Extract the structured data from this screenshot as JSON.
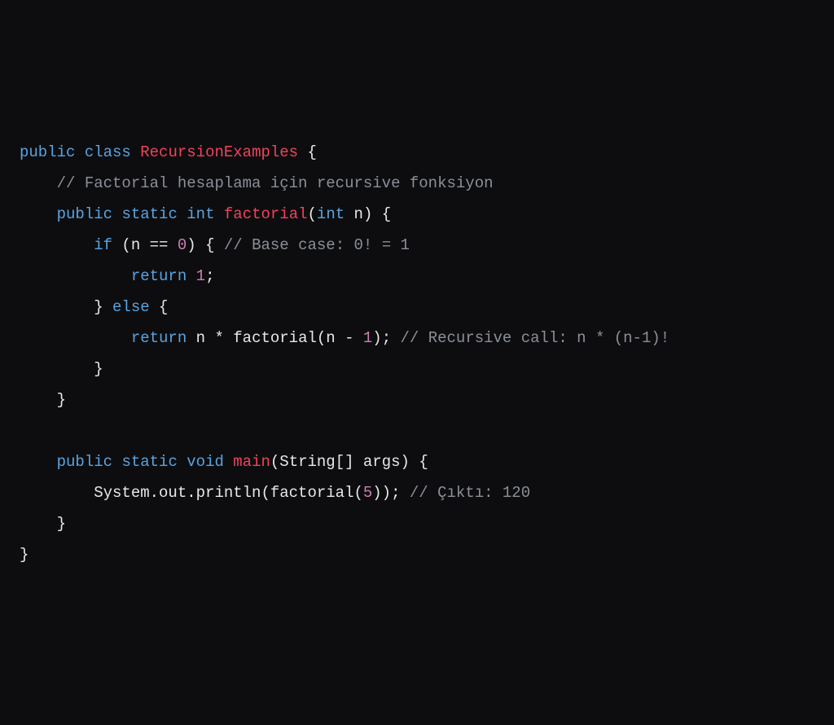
{
  "code": {
    "tokens": [
      [
        {
          "t": "public",
          "c": "kw"
        },
        {
          "t": " ",
          "c": "pn"
        },
        {
          "t": "class",
          "c": "kw"
        },
        {
          "t": " ",
          "c": "pn"
        },
        {
          "t": "RecursionExamples",
          "c": "cls"
        },
        {
          "t": " {",
          "c": "pn"
        }
      ],
      [
        {
          "t": "    ",
          "c": "pn"
        },
        {
          "t": "// Factorial hesaplama için recursive fonksiyon",
          "c": "cm"
        }
      ],
      [
        {
          "t": "    ",
          "c": "pn"
        },
        {
          "t": "public",
          "c": "kw"
        },
        {
          "t": " ",
          "c": "pn"
        },
        {
          "t": "static",
          "c": "kw"
        },
        {
          "t": " ",
          "c": "pn"
        },
        {
          "t": "int",
          "c": "type"
        },
        {
          "t": " ",
          "c": "pn"
        },
        {
          "t": "factorial",
          "c": "fn"
        },
        {
          "t": "(",
          "c": "pn"
        },
        {
          "t": "int",
          "c": "type"
        },
        {
          "t": " n) {",
          "c": "pn"
        }
      ],
      [
        {
          "t": "        ",
          "c": "pn"
        },
        {
          "t": "if",
          "c": "kw"
        },
        {
          "t": " (n ",
          "c": "pn"
        },
        {
          "t": "==",
          "c": "pn"
        },
        {
          "t": " ",
          "c": "pn"
        },
        {
          "t": "0",
          "c": "num"
        },
        {
          "t": ") { ",
          "c": "pn"
        },
        {
          "t": "// Base case: 0! = 1",
          "c": "cm"
        }
      ],
      [
        {
          "t": "            ",
          "c": "pn"
        },
        {
          "t": "return",
          "c": "kw"
        },
        {
          "t": " ",
          "c": "pn"
        },
        {
          "t": "1",
          "c": "num"
        },
        {
          "t": ";",
          "c": "pn"
        }
      ],
      [
        {
          "t": "        } ",
          "c": "pn"
        },
        {
          "t": "else",
          "c": "kw"
        },
        {
          "t": " {",
          "c": "pn"
        }
      ],
      [
        {
          "t": "            ",
          "c": "pn"
        },
        {
          "t": "return",
          "c": "kw"
        },
        {
          "t": " n * factorial(n - ",
          "c": "pn"
        },
        {
          "t": "1",
          "c": "num"
        },
        {
          "t": "); ",
          "c": "pn"
        },
        {
          "t": "// Recursive call: n * (n-1)!",
          "c": "cm"
        }
      ],
      [
        {
          "t": "        }",
          "c": "pn"
        }
      ],
      [
        {
          "t": "    }",
          "c": "pn"
        }
      ],
      [
        {
          "t": "",
          "c": "pn"
        }
      ],
      [
        {
          "t": "    ",
          "c": "pn"
        },
        {
          "t": "public",
          "c": "kw"
        },
        {
          "t": " ",
          "c": "pn"
        },
        {
          "t": "static",
          "c": "kw"
        },
        {
          "t": " ",
          "c": "pn"
        },
        {
          "t": "void",
          "c": "type"
        },
        {
          "t": " ",
          "c": "pn"
        },
        {
          "t": "main",
          "c": "fn"
        },
        {
          "t": "(String[] args) {",
          "c": "pn"
        }
      ],
      [
        {
          "t": "        System.out.println(factorial(",
          "c": "pn"
        },
        {
          "t": "5",
          "c": "num"
        },
        {
          "t": ")); ",
          "c": "pn"
        },
        {
          "t": "// Çıktı: 120",
          "c": "cm"
        }
      ],
      [
        {
          "t": "    }",
          "c": "pn"
        }
      ],
      [
        {
          "t": "}",
          "c": "pn"
        }
      ]
    ]
  }
}
